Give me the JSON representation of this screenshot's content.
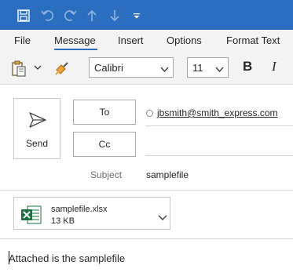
{
  "quick_access": {
    "save_icon": "save-icon",
    "undo_icon": "undo-icon",
    "redo_icon": "redo-icon",
    "up_icon": "arrow-up-icon",
    "down_icon": "arrow-down-icon",
    "customize_icon": "customize-qat-icon"
  },
  "tabs": [
    "File",
    "Message",
    "Insert",
    "Options",
    "Format Text"
  ],
  "active_tab": "Message",
  "ribbon": {
    "font_name": "Calibri",
    "font_size": "11",
    "bold_label": "B",
    "italic_label": "I"
  },
  "compose": {
    "send_label": "Send",
    "to_label": "To",
    "cc_label": "Cc",
    "to_recipient": "jbsmith@smith_express.com",
    "subject_label": "Subject",
    "subject_value": "samplefile"
  },
  "attachment": {
    "name": "samplefile.xlsx",
    "size": "13 KB",
    "icon": "excel-file-icon"
  },
  "body": {
    "text": "Attached is the samplefile"
  },
  "colors": {
    "titlebar": "#2b6ebf",
    "ribbon_bg": "#f3f3f3",
    "excel_green": "#1d6f42"
  }
}
